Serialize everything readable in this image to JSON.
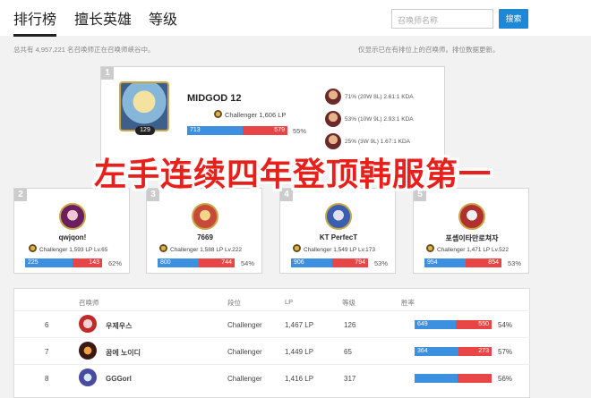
{
  "tabs": [
    "排行榜",
    "擅长英雄",
    "等级"
  ],
  "search": {
    "placeholder": "召唤师名称",
    "button": "搜索"
  },
  "info": {
    "left": "总共有 4,957,221 名召唤师正在召唤师峡谷中。",
    "right": "仅显示已在有排位上的召唤师。排位数据更新。"
  },
  "top": {
    "rank": "1",
    "name": "MIDGOD 12",
    "level": "129",
    "tier": "Challenger  1,606 LP",
    "wins": "713",
    "losses": "579",
    "pct": "55%",
    "wins_frac": 0.55,
    "champions": [
      {
        "text": "71% (20W 8L) 2.61:1 KDA"
      },
      {
        "text": "53% (10W 9L) 2.93:1 KDA"
      },
      {
        "text": "25% (3W 9L) 1.67:1 KDA"
      }
    ]
  },
  "cards": [
    {
      "rank": "2",
      "name": "qwjqon!",
      "tier": "Challenger  1,593 LP  Lv.65",
      "wins": "225",
      "losses": "143",
      "pct": "62%",
      "wins_frac": 0.62
    },
    {
      "rank": "3",
      "name": "7669",
      "tier": "Challenger  1,588 LP  Lv.222",
      "wins": "800",
      "losses": "744",
      "pct": "54%",
      "wins_frac": 0.54
    },
    {
      "rank": "4",
      "name": "KT PerfecT",
      "tier": "Challenger  1,549 LP  Lv.173",
      "wins": "906",
      "losses": "794",
      "pct": "53%",
      "wins_frac": 0.53
    },
    {
      "rank": "5",
      "name": "포셉이타만로쳐자",
      "tier": "Challenger  1,471 LP  Lv.522",
      "wins": "954",
      "losses": "854",
      "pct": "53%",
      "wins_frac": 0.53
    }
  ],
  "banner": "左手连续四年登顶韩服第一",
  "table": {
    "headers": [
      "召唤师",
      "段位",
      "LP",
      "等级",
      "胜率"
    ],
    "rows": [
      {
        "rank": "6",
        "name": "우제우스",
        "tier": "Challenger",
        "lp": "1,467 LP",
        "level": "126",
        "wins": "649",
        "losses": "550",
        "pct": "54%",
        "wins_frac": 0.54
      },
      {
        "rank": "7",
        "name": "꿈에 노이디",
        "tier": "Challenger",
        "lp": "1,449 LP",
        "level": "65",
        "wins": "364",
        "losses": "273",
        "pct": "57%",
        "wins_frac": 0.57
      },
      {
        "rank": "8",
        "name": "GGGorl",
        "tier": "Challenger",
        "lp": "1,416 LP",
        "level": "317",
        "wins": "",
        "losses": "",
        "pct": "56%",
        "wins_frac": 0.56
      }
    ]
  },
  "colors": {
    "win": "#3d8fe0",
    "loss": "#e84646",
    "accent": "#1e88d6",
    "banner": "#e8201b"
  }
}
